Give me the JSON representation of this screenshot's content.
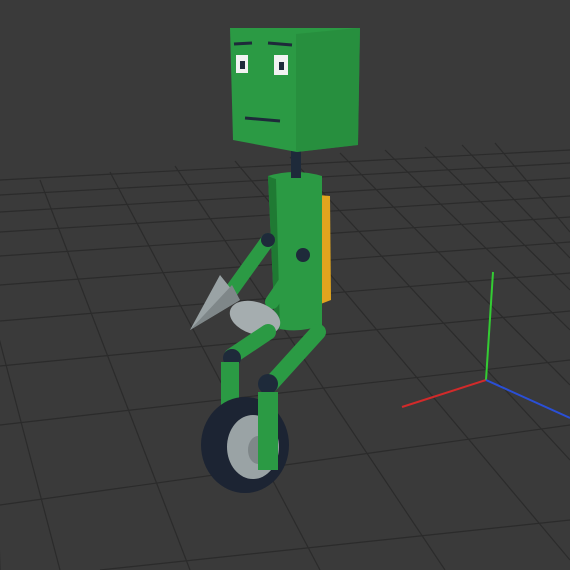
{
  "scene": {
    "background_color": "#3a3a3a",
    "grid_color": "#2a2a2a",
    "axis_colors": {
      "x": "#d22a2a",
      "y": "#33cc33",
      "z": "#2a4fd6"
    },
    "robot": {
      "body_color": "#2b9a44",
      "body_shade": "#1f7a33",
      "backpack_color": "#e0a41e",
      "joint_color": "#1e2a3a",
      "tool_color": "#9aa3a5",
      "wheel_tire_color": "#1c2433",
      "wheel_hub_color": "#9aa3a5"
    },
    "icons": {
      "head": "robot-head-icon",
      "wheel": "wheel-icon",
      "gizmo": "axis-gizmo-icon"
    }
  }
}
